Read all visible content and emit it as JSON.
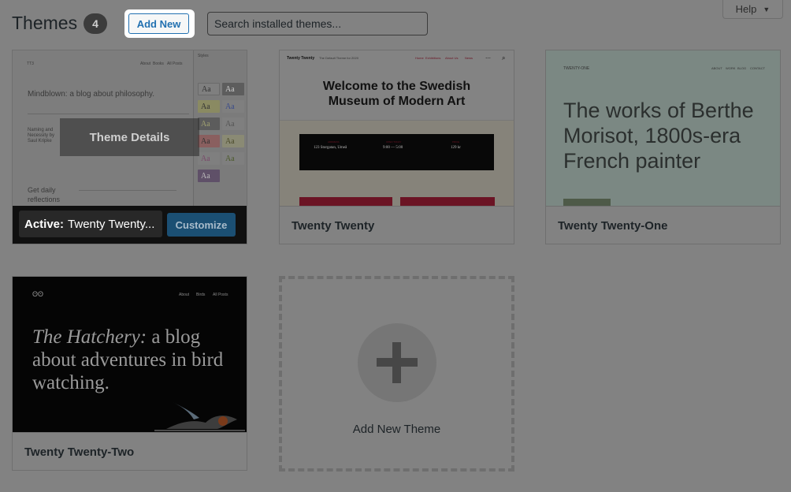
{
  "header": {
    "title": "Themes",
    "count": "4",
    "add_new_label": "Add New",
    "search_placeholder": "Search installed themes...",
    "help_label": "Help"
  },
  "themes": [
    {
      "name": "Twenty Twenty-Three",
      "active": true,
      "active_prefix": "Active:",
      "active_name": "Twenty Twenty...",
      "details_label": "Theme Details",
      "customize_label": "Customize",
      "shot": {
        "site_title": "TT3",
        "nav": [
          "About",
          "Books",
          "All Posts"
        ],
        "tagline": "Mindblown: a blog about philosophy.",
        "post_title": "Naming and Necessity by Saul Kripke",
        "side_heading": "Get daily reflections",
        "styles_header": "Styles",
        "style_swatch": "Aa"
      }
    },
    {
      "name": "Twenty Twenty",
      "shot": {
        "site_title": "Twenty Twenty",
        "tagline": "The Default Theme for 2020",
        "nav": [
          "Home",
          "Exhibitions",
          "About Us",
          "News"
        ],
        "heading": "Welcome to the Swedish Museum of Modern Art",
        "box": [
          {
            "label": "ADDRESS",
            "value": "123 Storgatan, Umeå"
          },
          {
            "label": "OPEN TODAY",
            "value": "9:00 — 5:00"
          },
          {
            "label": "PRICE",
            "value": "129 kr"
          }
        ]
      }
    },
    {
      "name": "Twenty Twenty-One",
      "shot": {
        "site_title": "TWENTY-ONE",
        "nav": [
          "ABOUT",
          "WORK",
          "BLOG",
          "CONTACT"
        ],
        "heading": "The works of Berthe Morisot, 1800s-era French painter"
      }
    },
    {
      "name": "Twenty Twenty-Two",
      "shot": {
        "nav": [
          "About",
          "Birds",
          "All Posts"
        ],
        "heading_italic": "The Hatchery:",
        "heading_rest": "a blog about adventures in bird watching."
      }
    }
  ],
  "add_new_theme_label": "Add New Theme"
}
